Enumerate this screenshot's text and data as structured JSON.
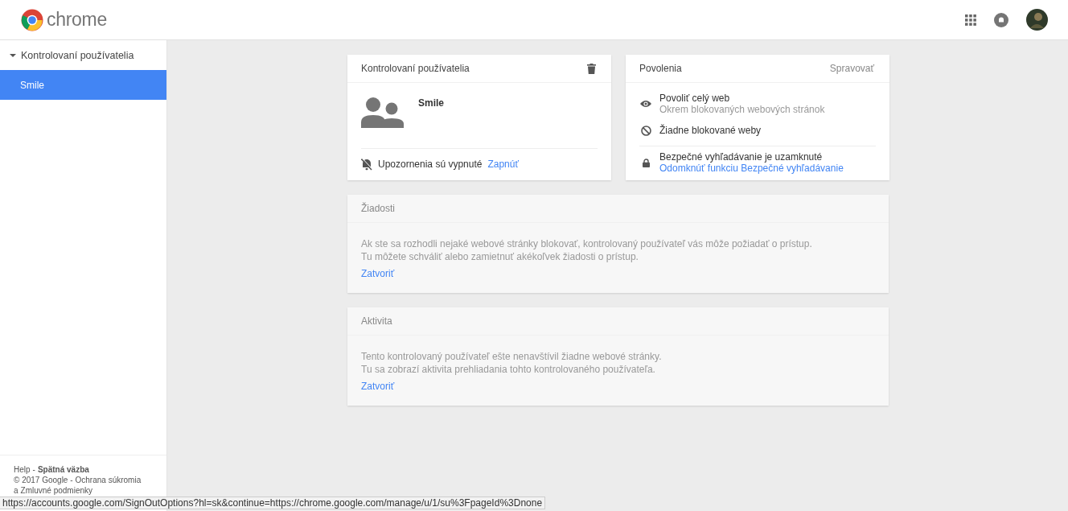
{
  "header": {
    "logo_text": "chrome"
  },
  "sidebar": {
    "groups": [
      {
        "label": "Kontrolovaní používatelia",
        "expanded": true,
        "children": [
          {
            "label": "Smile",
            "selected": true
          }
        ]
      }
    ],
    "footer": {
      "lines": [
        [
          {
            "kind": "link",
            "text": "Help"
          },
          {
            "kind": "text",
            "text": "-"
          },
          {
            "kind": "strong_link",
            "text": "Spätná väzba"
          }
        ],
        [
          {
            "kind": "text",
            "text": "© 2017 Google -"
          },
          {
            "kind": "link",
            "text": "Ochrana súkromia"
          },
          {
            "kind": "text",
            "text": "a"
          },
          {
            "kind": "link",
            "text": "Zmluvné podmienky"
          }
        ]
      ]
    }
  },
  "user_card": {
    "title": "Kontrolovaní používatelia",
    "name": "Smile",
    "notifications": {
      "text": "Upozornenia sú vypnuté",
      "action": "Zapnúť"
    }
  },
  "permissions_card": {
    "title": "Povolenia",
    "action": "Spravovať",
    "items": [
      {
        "kind": "eye",
        "title": "Povoliť celý web",
        "subtitle": "Okrem blokovaných webových stránok"
      },
      {
        "kind": "block",
        "title": "Žiadne blokované weby"
      },
      {
        "kind": "lock",
        "title": "Bezpečné vyhľadávanie je uzamknuté",
        "link": "Odomknúť funkciu Bezpečné vyhľadávanie"
      }
    ]
  },
  "info_cards": [
    {
      "title": "Žiadosti",
      "lines": [
        "Ak ste sa rozhodli nejaké webové stránky blokovať, kontrolovaný používateľ vás môže požiadať o prístup.",
        "Tu môžete schváliť alebo zamietnuť akékoľvek žiadosti o prístup."
      ],
      "action": "Zatvoriť"
    },
    {
      "title": "Aktivita",
      "lines": [
        "Tento kontrolovaný používateľ ešte nenavštívil žiadne webové stránky.",
        "Tu sa zobrazí aktivita prehliadania tohto kontrolovaného používateľa."
      ],
      "action": "Zatvoriť"
    }
  ],
  "status_bar": {
    "url": "https://accounts.google.com/SignOutOptions?hl=sk&continue=https://chrome.google.com/manage/u/1/su%3FpageId%3Dnone"
  }
}
